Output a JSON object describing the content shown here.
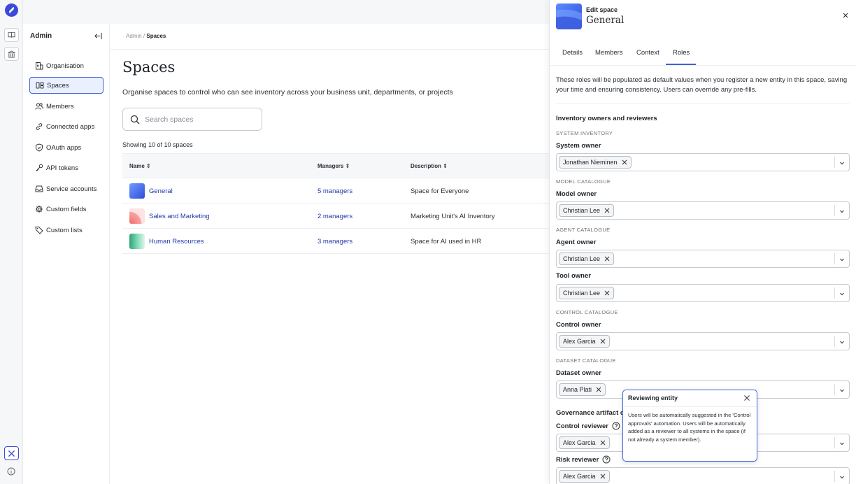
{
  "sidebar": {
    "header": "Admin",
    "items": [
      {
        "label": "Organisation",
        "icon": "building-icon"
      },
      {
        "label": "Spaces",
        "icon": "spaces-icon",
        "active": true
      },
      {
        "label": "Members",
        "icon": "members-icon"
      },
      {
        "label": "Connected apps",
        "icon": "link-icon"
      },
      {
        "label": "OAuth apps",
        "icon": "shield-icon"
      },
      {
        "label": "API tokens",
        "icon": "key-icon"
      },
      {
        "label": "Service accounts",
        "icon": "inbox-icon"
      },
      {
        "label": "Custom fields",
        "icon": "gear-icon"
      },
      {
        "label": "Custom lists",
        "icon": "tag-icon"
      }
    ]
  },
  "breadcrumb": {
    "parent": "Admin",
    "sep": " / ",
    "current": "Spaces"
  },
  "page": {
    "title": "Spaces",
    "description": "Organise spaces to control who can see inventory across your business unit, departments, or projects",
    "search_placeholder": "Search spaces",
    "showing": "Showing 10 of 10 spaces"
  },
  "table": {
    "columns": [
      "Name",
      "Managers",
      "Description"
    ],
    "rows": [
      {
        "name": "General",
        "managers": "5 managers",
        "description": "Space for Everyone"
      },
      {
        "name": "Sales and Marketing",
        "managers": "2 managers",
        "description": "Marketing Unit's AI Inventory"
      },
      {
        "name": "Human Resources",
        "managers": "3 managers",
        "description": "Space for AI used in HR"
      }
    ]
  },
  "panel": {
    "eyebrow": "Edit space",
    "title": "General",
    "tabs": [
      "Details",
      "Members",
      "Context",
      "Roles"
    ],
    "active_tab": "Roles",
    "intro": "These roles will be populated as default values when you register a new entity in this space, saving your time and ensuring consistency. Users can override any pre-fills.",
    "section1": "Inventory owners and reviewers",
    "cat_system": "SYSTEM INVENTORY",
    "system_owner_label": "System owner",
    "system_owner": "Jonathan Nieminen",
    "cat_model": "MODEL CATALOGUE",
    "model_owner_label": "Model owner",
    "model_owner": "Christian Lee",
    "cat_agent": "AGENT CATALOGUE",
    "agent_owner_label": "Agent owner",
    "agent_owner": "Christian Lee",
    "tool_owner_label": "Tool owner",
    "tool_owner": "Christian Lee",
    "cat_control": "CONTROL CATALOGUE",
    "control_owner_label": "Control owner",
    "control_owner": "Alex Garcia",
    "cat_dataset": "DATASET CATALOGUE",
    "dataset_owner_label": "Dataset owner",
    "dataset_owner": "Anna Plati",
    "section2": "Governance artifact o",
    "control_reviewer_label": "Control reviewer",
    "control_reviewer": "Alex Garcia",
    "risk_reviewer_label": "Risk reviewer",
    "risk_reviewer": "Alex Garcia"
  },
  "tooltip": {
    "title": "Reviewing entity",
    "body": "Users will be automatically suggested in the 'Control approvals' automation. Users will be automatically added as a reviewer to all systems in the space (if not already a system member)."
  },
  "colors": {
    "accent": "#3a63d8",
    "link": "#1f3aa8",
    "brand": "#3a4bd8"
  }
}
